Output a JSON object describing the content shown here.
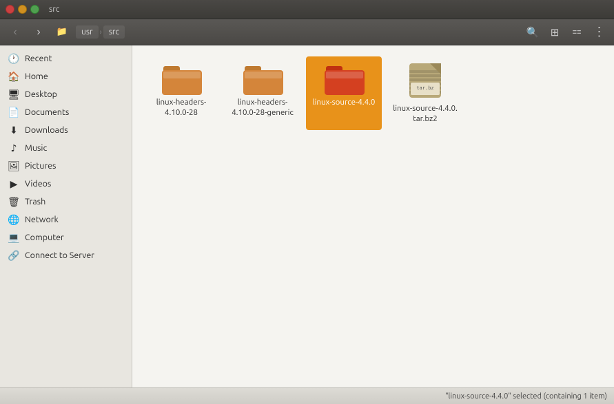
{
  "window": {
    "title": "src",
    "controls": {
      "close": "×",
      "minimize": "−",
      "maximize": "+"
    }
  },
  "toolbar": {
    "back_label": "‹",
    "forward_label": "›",
    "breadcrumb": [
      "usr",
      "src"
    ],
    "search_icon": "🔍",
    "view_grid_icon": "⊞",
    "view_list_icon": "⋮⋮⋮",
    "menu_icon": "⋮"
  },
  "sidebar": {
    "items": [
      {
        "id": "recent",
        "label": "Recent",
        "icon": "🕐"
      },
      {
        "id": "home",
        "label": "Home",
        "icon": "🏠"
      },
      {
        "id": "desktop",
        "label": "Desktop",
        "icon": "🖥"
      },
      {
        "id": "documents",
        "label": "Documents",
        "icon": "📄"
      },
      {
        "id": "downloads",
        "label": "Downloads",
        "icon": "⬇"
      },
      {
        "id": "music",
        "label": "Music",
        "icon": "♪"
      },
      {
        "id": "pictures",
        "label": "Pictures",
        "icon": "🖼"
      },
      {
        "id": "videos",
        "label": "Videos",
        "icon": "▶"
      },
      {
        "id": "trash",
        "label": "Trash",
        "icon": "🗑"
      },
      {
        "id": "network",
        "label": "Network",
        "icon": "🌐"
      },
      {
        "id": "computer",
        "label": "Computer",
        "icon": "💻"
      },
      {
        "id": "connect",
        "label": "Connect to Server",
        "icon": "🔗"
      }
    ]
  },
  "files": [
    {
      "id": "linux-headers-4.10.0-28",
      "label": "linux-headers-\n4.10.0-28",
      "type": "folder",
      "color": "#d4853a",
      "selected": false
    },
    {
      "id": "linux-headers-4.10.0-28-generic",
      "label": "linux-headers-\n4.10.0-28-generic",
      "type": "folder",
      "color": "#d4853a",
      "selected": false
    },
    {
      "id": "linux-source-4.4.0",
      "label": "linux-source-4.4.0",
      "type": "folder",
      "color": "#d44020",
      "selected": true
    },
    {
      "id": "linux-source-4.4.0.tar.bz2",
      "label": "linux-source-4.4.0.\ntar.bz2",
      "type": "archive",
      "selected": false
    }
  ],
  "statusbar": {
    "text": "\"linux-source-4.4.0\" selected (containing 1 item)"
  }
}
